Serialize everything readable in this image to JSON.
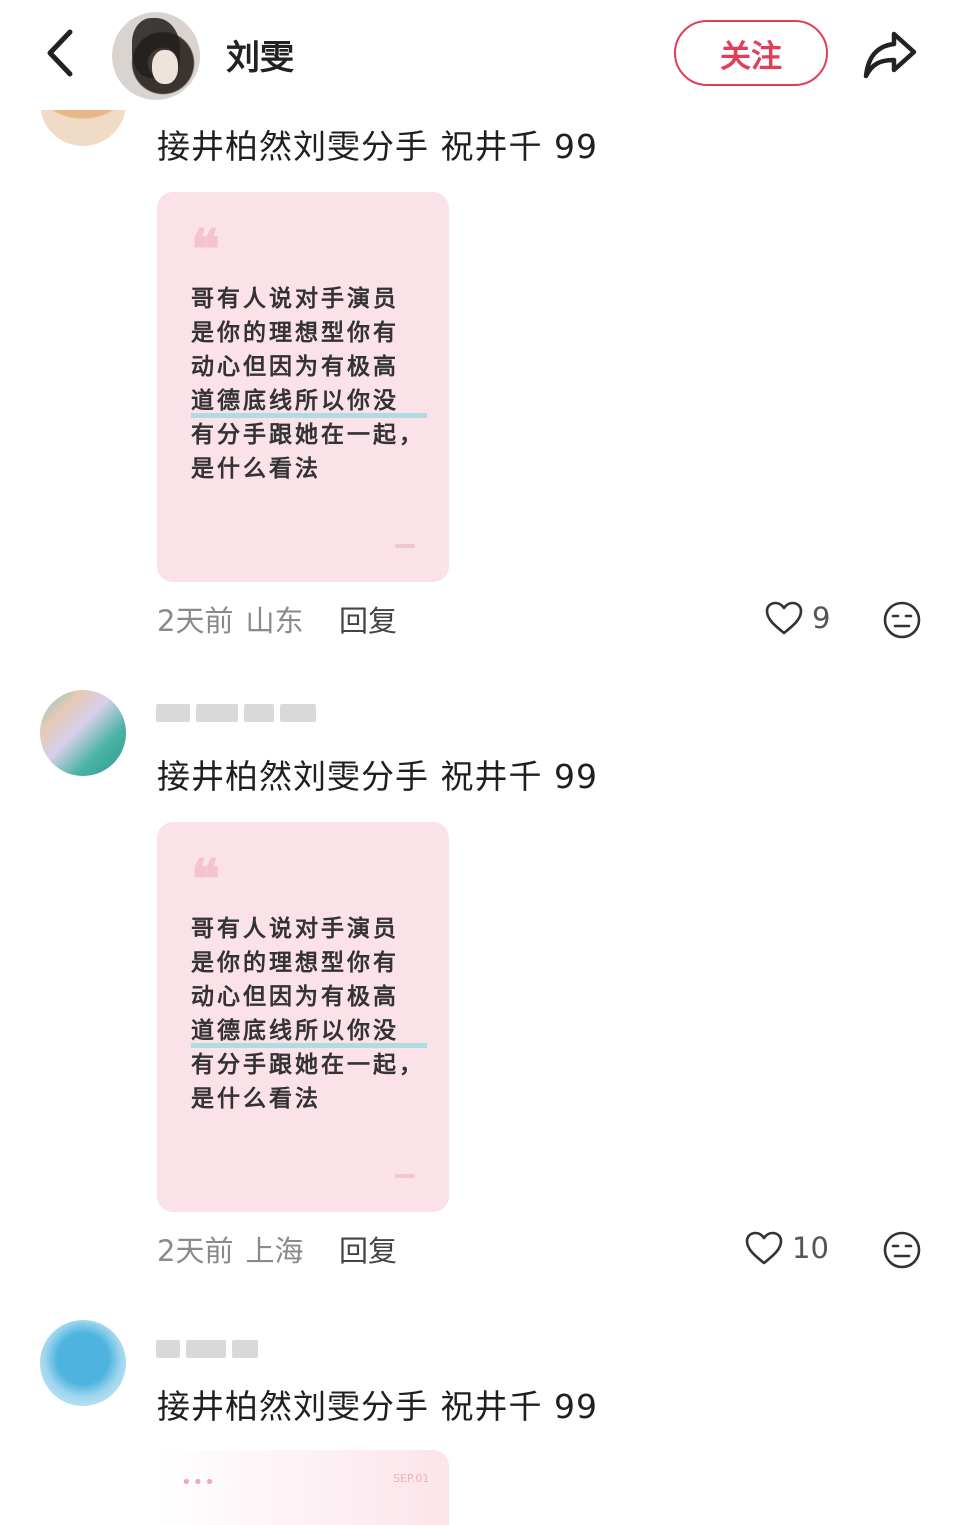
{
  "header": {
    "name": "刘雯",
    "follow_label": "关注"
  },
  "comments": [
    {
      "text": "接井柏然刘雯分手 祝井千 99",
      "card": {
        "quote_mark": "❝",
        "lines": [
          "哥有人说对手演员",
          "是你的理想型你有",
          "动心但因为有极高",
          "道德底线所以你没",
          "有分手跟她在一起，",
          "是什么看法"
        ]
      },
      "time": "2天前",
      "location": "山东",
      "reply_label": "回复",
      "likes": "9"
    },
    {
      "text": "接井柏然刘雯分手 祝井千 99",
      "card": {
        "quote_mark": "❝",
        "lines": [
          "哥有人说对手演员",
          "是你的理想型你有",
          "动心但因为有极高",
          "道德底线所以你没",
          "有分手跟她在一起，",
          "是什么看法"
        ]
      },
      "time": "2天前",
      "location": "上海",
      "reply_label": "回复",
      "likes": "10"
    },
    {
      "text": "接井柏然刘雯分手 祝井千 99",
      "card": {
        "dots": "•••",
        "tag": "SEP.01"
      }
    }
  ],
  "colors": {
    "accent": "#e23e57",
    "card_bg": "#fbe1e8",
    "highlight": "#6ed7dc"
  },
  "icons": [
    "back-arrow-icon",
    "share-icon",
    "heart-icon",
    "emoji-face-icon"
  ]
}
